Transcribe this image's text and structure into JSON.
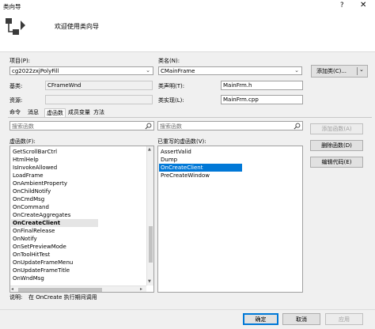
{
  "window": {
    "title": "类向导",
    "help_glyph": "?",
    "close_glyph": "✕"
  },
  "header": {
    "title": "欢迎使用类向导"
  },
  "project": {
    "label": "项目(P):",
    "value": "cg2022zxjPolyFill"
  },
  "classname": {
    "label": "类名(N):",
    "value": "CMainFrame"
  },
  "add_class_button": "添加类(C)...",
  "base": {
    "label": "基类:",
    "value": "CFrameWnd"
  },
  "class_decl": {
    "label": "类声明(T):",
    "value": "MainFrm.h"
  },
  "resource": {
    "label": "资源:",
    "value": ""
  },
  "class_impl": {
    "label": "类实现(L):",
    "value": "MainFrm.cpp"
  },
  "tabs": [
    "命令",
    "消息",
    "虚函数",
    "成员变量",
    "方法"
  ],
  "active_tab": "虚函数",
  "search_left": {
    "placeholder": "搜索函数"
  },
  "search_right": {
    "placeholder": "搜索函数"
  },
  "virtual_functions": {
    "label": "虚函数(F):",
    "items": [
      "GetScrollBarCtrl",
      "HtmlHelp",
      "IsInvokeAllowed",
      "LoadFrame",
      "OnAmbientProperty",
      "OnChildNotify",
      "OnCmdMsg",
      "OnCommand",
      "OnCreateAggregates",
      "OnCreateClient",
      "OnFinalRelease",
      "OnNotify",
      "OnSetPreviewMode",
      "OnToolHitTest",
      "OnUpdateFrameMenu",
      "OnUpdateFrameTitle",
      "OnWndMsg"
    ],
    "selected": "OnCreateClient"
  },
  "overridden": {
    "label": "已重写的虚函数(V):",
    "items": [
      "AssertValid",
      "Dump",
      "OnCreateClient",
      "PreCreateWindow"
    ],
    "selected": "OnCreateClient"
  },
  "actions": {
    "add_function": "添加函数(A)",
    "delete_function": "删除函数(D)",
    "edit_code": "编辑代码(E)"
  },
  "description": {
    "label": "说明:",
    "text": "在 OnCreate 执行期间调用"
  },
  "footer": {
    "ok": "确定",
    "cancel": "取消",
    "apply": "应用"
  },
  "colors": {
    "accent": "#0078d7",
    "selection": "#0078d7"
  }
}
